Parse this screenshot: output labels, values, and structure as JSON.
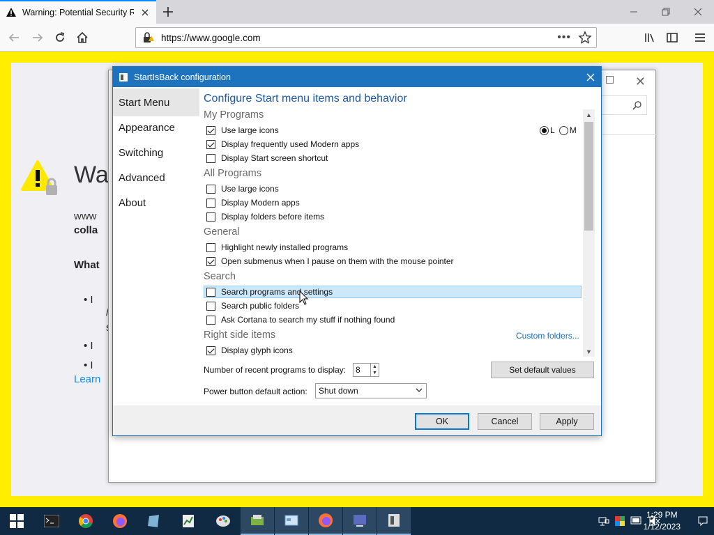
{
  "browser": {
    "tab_title": "Warning: Potential Security Ris",
    "url": "https://www.google.com",
    "dots": "•••"
  },
  "page": {
    "heading": "Wa",
    "line1": "www",
    "line2": "colla",
    "what": "What",
    "bullets": [
      "I",
      "I",
      "I"
    ],
    "bullet_sub1": "/",
    "bullet_sub2": "s",
    "learn": "Learn"
  },
  "dialog": {
    "title": "StartIsBack configuration",
    "nav": [
      "Start Menu",
      "Appearance",
      "Switching",
      "Advanced",
      "About"
    ],
    "selected_nav": "Start Menu",
    "heading": "Configure Start menu items and behavior",
    "sections": {
      "my_programs": "My Programs",
      "all_programs": "All Programs",
      "general": "General",
      "search": "Search",
      "right_side": "Right side items"
    },
    "options": {
      "mp_large_icons": {
        "label": "Use large icons",
        "checked": true
      },
      "mp_modern_apps": {
        "label": "Display frequently used Modern apps",
        "checked": true
      },
      "mp_start_screen": {
        "label": "Display Start screen shortcut",
        "checked": false
      },
      "ap_large_icons": {
        "label": "Use large icons",
        "checked": false
      },
      "ap_modern_apps": {
        "label": "Display Modern apps",
        "checked": false
      },
      "ap_folders_before": {
        "label": "Display folders before items",
        "checked": false
      },
      "gen_highlight": {
        "label": "Highlight newly installed programs",
        "checked": false
      },
      "gen_submenus": {
        "label": "Open submenus when I pause on them with the mouse pointer",
        "checked": true
      },
      "s_programs": {
        "label": "Search programs and settings",
        "checked": false
      },
      "s_public": {
        "label": "Search public folders",
        "checked": false
      },
      "s_cortana": {
        "label": "Ask Cortana to search my stuff if nothing found",
        "checked": false
      },
      "rs_glyph": {
        "label": "Display glyph icons",
        "checked": true
      }
    },
    "radio": {
      "l": "L",
      "m": "M",
      "selected": "L"
    },
    "custom_folders": "Custom folders...",
    "recent_label": "Number of recent programs to display:",
    "recent_value": "8",
    "set_default": "Set default values",
    "power_label": "Power button default action:",
    "power_value": "Shut down",
    "ok": "OK",
    "cancel": "Cancel",
    "apply": "Apply"
  },
  "taskbar": {
    "time": "1:29 PM",
    "date": "1/12/2023"
  }
}
